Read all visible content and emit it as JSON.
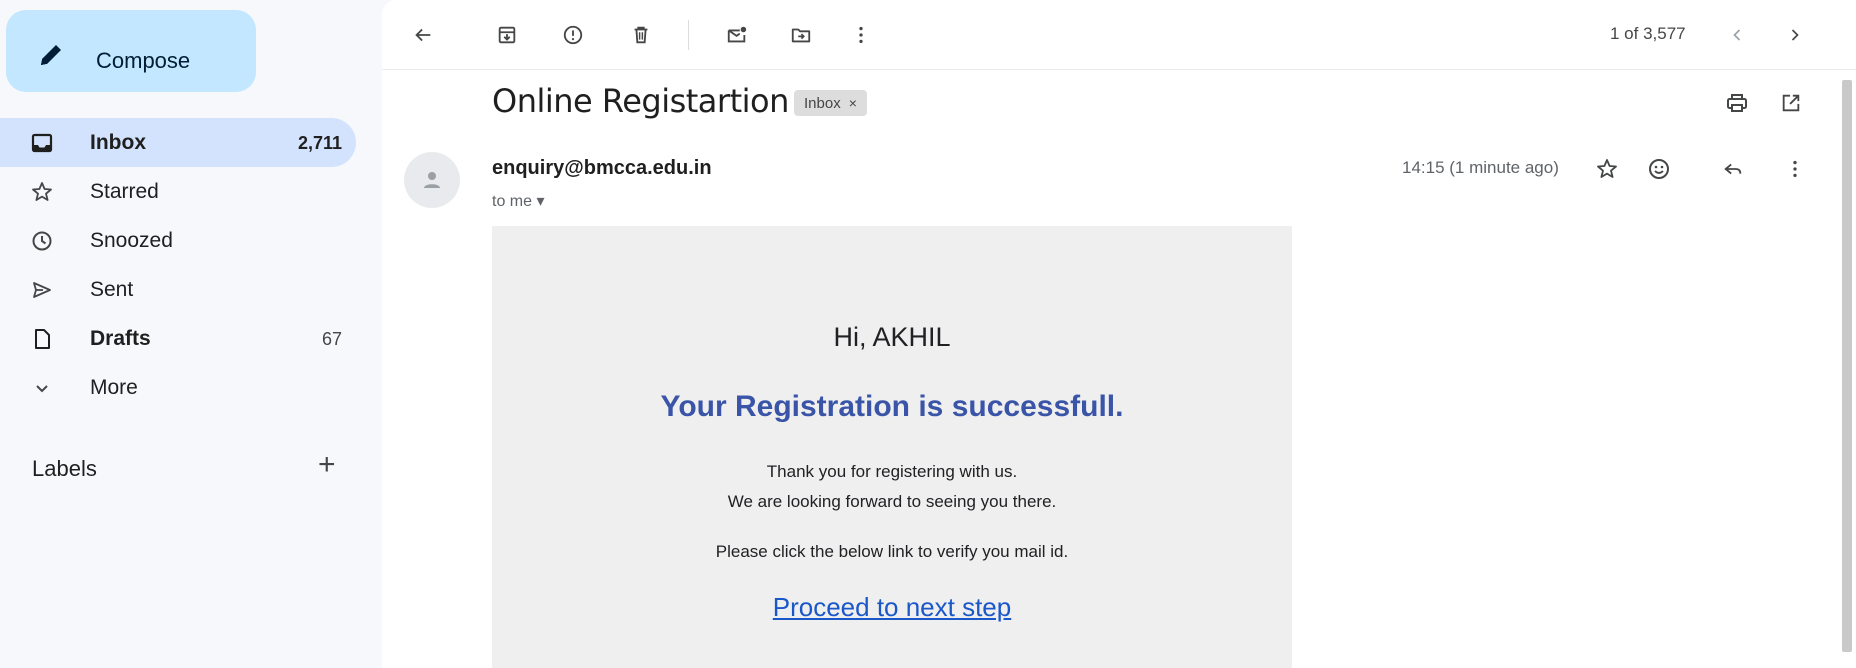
{
  "sidebar": {
    "compose_label": "Compose",
    "items": [
      {
        "label": "Inbox",
        "count": "2,711",
        "icon": "inbox-icon"
      },
      {
        "label": "Starred",
        "count": "",
        "icon": "star-icon"
      },
      {
        "label": "Snoozed",
        "count": "",
        "icon": "clock-icon"
      },
      {
        "label": "Sent",
        "count": "",
        "icon": "send-icon"
      },
      {
        "label": "Drafts",
        "count": "67",
        "icon": "draft-icon"
      },
      {
        "label": "More",
        "count": "",
        "icon": "chevron-down-icon"
      }
    ],
    "labels_heading": "Labels",
    "labels_add": "+"
  },
  "toolbar": {
    "pager_text": "1 of 3,577"
  },
  "email": {
    "subject": "Online Registartion",
    "chip_label": "Inbox",
    "chip_close": "×",
    "sender": "enquiry@bmcca.edu.in",
    "to_me": "to me ▾",
    "timestamp": "14:15 (1 minute ago)",
    "body": {
      "greeting": "Hi, AKHIL",
      "success": "Your Registration is successfull.",
      "thanks_line1": "Thank you for registering with us.",
      "thanks_line2": "We are looking forward to seeing you there.",
      "click_note": "Please click the below link to verify you mail id.",
      "link_text": "Proceed to next step"
    }
  },
  "colors": {
    "compose_bg": "#c2e7ff",
    "active_nav_bg": "#d3e3fd",
    "success_text": "#3a55a8",
    "link": "#1a57c9",
    "email_body_bg": "#efefef"
  }
}
